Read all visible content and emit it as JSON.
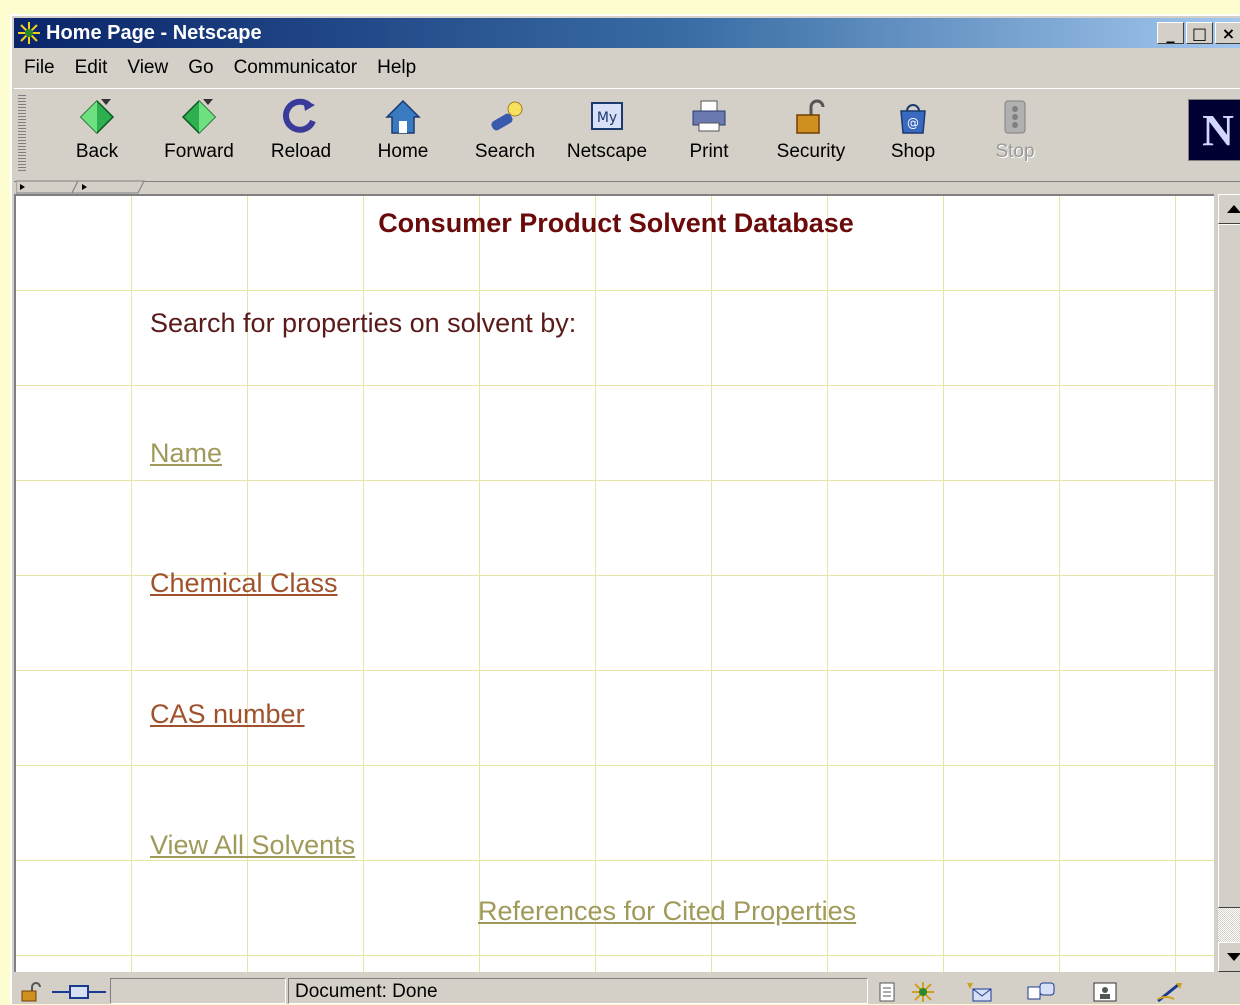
{
  "window": {
    "title": "Home Page - Netscape",
    "controls": [
      "_",
      "□",
      "×"
    ]
  },
  "menu": [
    "File",
    "Edit",
    "View",
    "Go",
    "Communicator",
    "Help"
  ],
  "toolbar": {
    "back": "Back",
    "forward": "Forward",
    "reload": "Reload",
    "home": "Home",
    "search": "Search",
    "netscape": "Netscape",
    "print": "Print",
    "security": "Security",
    "shop": "Shop",
    "stop": "Stop",
    "logo": "N"
  },
  "page": {
    "title": "Consumer Product Solvent Database",
    "intro": "Search for properties on solvent by:",
    "links": [
      "Name",
      "Chemical Class",
      "CAS number",
      "View All Solvents"
    ],
    "references": "References for Cited Properties"
  },
  "status": {
    "text": "Document: Done"
  },
  "colors": {
    "title": "#6b0a0a",
    "link_unvisited": "#a09a5a",
    "link_visited": "#a0522d",
    "grid": "#e6e5a6"
  }
}
